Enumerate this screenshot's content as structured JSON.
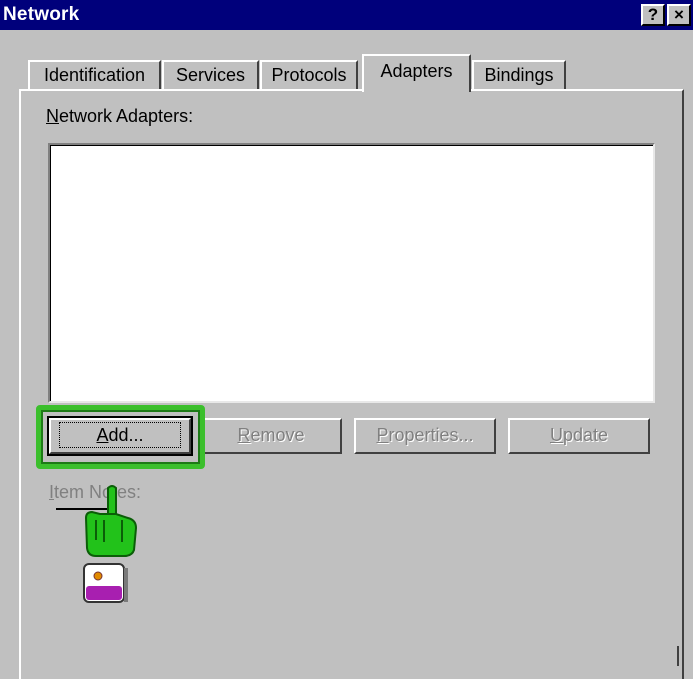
{
  "window": {
    "title": "Network",
    "help_button": "?",
    "close_button": "×"
  },
  "tabs": [
    {
      "label": "Identification",
      "active": false
    },
    {
      "label": "Services",
      "active": false
    },
    {
      "label": "Protocols",
      "active": false
    },
    {
      "label": "Adapters",
      "active": true
    },
    {
      "label": "Bindings",
      "active": false
    }
  ],
  "adapters_panel": {
    "label_prefix": "",
    "label_mnemonic": "N",
    "label_rest": "etwork Adapters:",
    "items": []
  },
  "buttons": {
    "add": {
      "mnemonic": "A",
      "rest": "dd..."
    },
    "remove": {
      "mnemonic": "R",
      "rest": "emove"
    },
    "properties": {
      "mnemonic": "P",
      "rest": "roperties..."
    },
    "update": {
      "mnemonic": "U",
      "rest": "pdate"
    }
  },
  "item_notes": {
    "mnemonic": "I",
    "rest": "tem Notes:"
  },
  "colors": {
    "titlebar": "#00007b",
    "face": "#c0c0c0",
    "highlight": "#3bbf2c"
  },
  "icons": [
    "help-icon",
    "close-icon",
    "pointing-hand-cursor-icon"
  ]
}
